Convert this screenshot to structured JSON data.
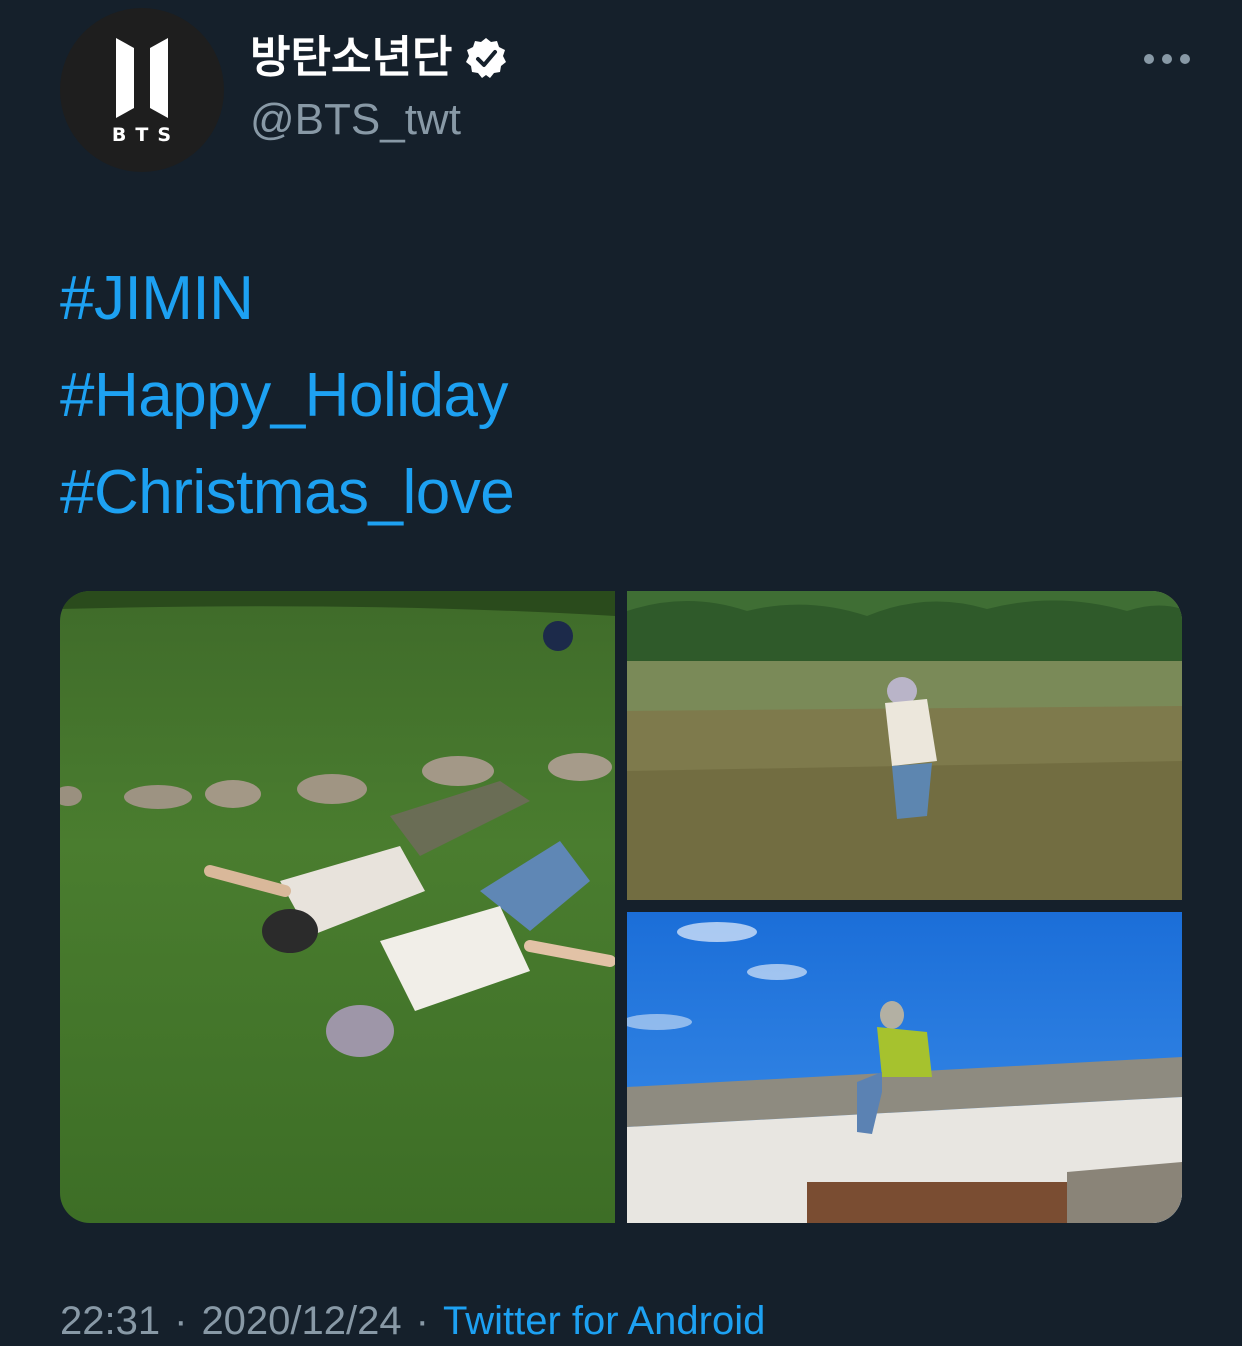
{
  "author": {
    "display_name": "방탄소년단",
    "handle": "@BTS_twt",
    "avatar_caption": "BTS",
    "verified": true
  },
  "header": {
    "more_icon": "more-horizontal-icon"
  },
  "tweet": {
    "hashtags": [
      "#JIMIN",
      "#Happy_Holiday",
      "#Christmas_love"
    ]
  },
  "media": {
    "photos": [
      "photo-lying-on-grass",
      "photo-standing-in-river",
      "photo-sitting-on-roof"
    ]
  },
  "meta": {
    "time": "22:31",
    "date": "2020/12/24",
    "separator": "·",
    "source": "Twitter for Android"
  },
  "colors": {
    "background": "#15202b",
    "link": "#1da1f2",
    "secondary_text": "#8899a6"
  }
}
